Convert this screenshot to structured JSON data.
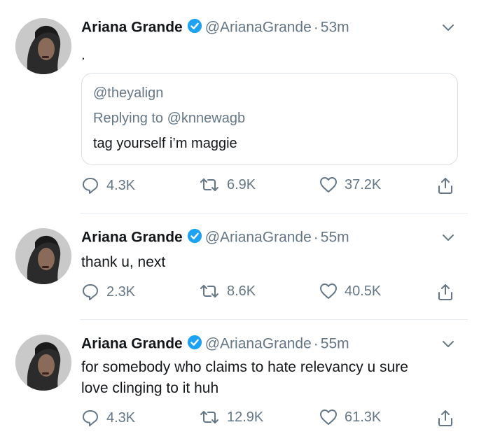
{
  "tweets": [
    {
      "author_name": "Ariana Grande",
      "handle": "@ArianaGrande",
      "separator": "·",
      "time": "53m",
      "text": ".",
      "quote": {
        "handle": "@theyalign",
        "replying_to": "Replying to @knnewagb",
        "text": "tag yourself i’m maggie"
      },
      "replies": "4.3K",
      "retweets": "6.9K",
      "likes": "37.2K"
    },
    {
      "author_name": "Ariana Grande",
      "handle": "@ArianaGrande",
      "separator": "·",
      "time": "55m",
      "text": "thank u, next",
      "replies": "2.3K",
      "retweets": "8.6K",
      "likes": "40.5K"
    },
    {
      "author_name": "Ariana Grande",
      "handle": "@ArianaGrande",
      "separator": "·",
      "time": "55m",
      "text_line1": "for somebody who claims to hate relevancy u sure",
      "text_line2": "love clinging to it huh",
      "replies": "4.3K",
      "retweets": "12.9K",
      "likes": "61.3K"
    }
  ],
  "icons": {
    "verified": "verified-badge-icon",
    "menu": "chevron-down-icon",
    "reply": "reply-icon",
    "retweet": "retweet-icon",
    "like": "like-icon",
    "share": "share-icon"
  },
  "colors": {
    "verified": "#1da1f2",
    "secondary_text": "#657786",
    "primary_text": "#14171a",
    "divider": "#e6ecf0"
  }
}
